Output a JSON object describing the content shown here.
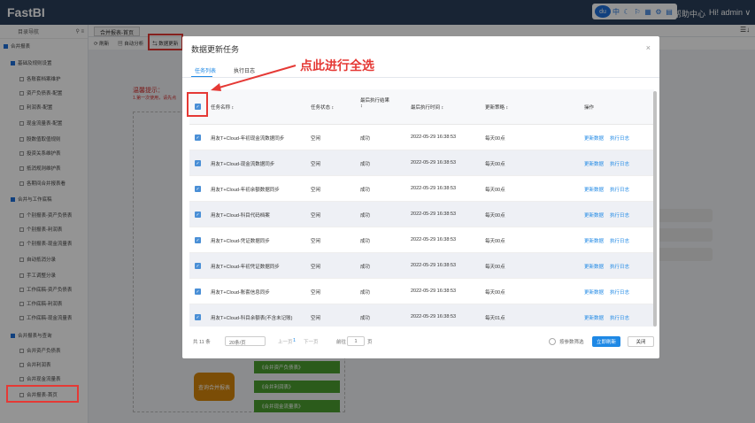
{
  "app": {
    "brand": "FastBI"
  },
  "topbar": {
    "icons": [
      "du-icon",
      "中",
      "☾",
      "⚐",
      "▦",
      "⚙",
      "▤"
    ],
    "help": "帮助中心",
    "user": "Hi! admin ∨"
  },
  "sidebar": {
    "head": "目录导航",
    "items": [
      {
        "label": "合并报表",
        "type": "group"
      },
      {
        "label": "基础及规则设置",
        "type": "group"
      },
      {
        "label": "各账套档案维护"
      },
      {
        "label": "资产负债表-配置"
      },
      {
        "label": "利润表-配置"
      },
      {
        "label": "现金流量表-配置"
      },
      {
        "label": "股数值取值规则"
      },
      {
        "label": "投资关系维护表"
      },
      {
        "label": "抵消规则维护表"
      },
      {
        "label": "各期间合并报表看"
      },
      {
        "label": "合并与工作底稿",
        "type": "group"
      },
      {
        "label": "个别报表-资产负债表"
      },
      {
        "label": "个别报表-利润表"
      },
      {
        "label": "个别报表-现金流量表"
      },
      {
        "label": "自动抵消分录"
      },
      {
        "label": "手工调整分录"
      },
      {
        "label": "工作底稿-资产负债表"
      },
      {
        "label": "工作底稿-利润表"
      },
      {
        "label": "工作底稿-现金流量表"
      },
      {
        "label": "合并报表与查询",
        "type": "group"
      },
      {
        "label": "合并资产负债表"
      },
      {
        "label": "合并利润表"
      },
      {
        "label": "合并现金流量表"
      },
      {
        "label": "合并报表-首页",
        "active": true
      }
    ]
  },
  "tabs": [
    {
      "label": "合并报表-首页"
    }
  ],
  "toolbar": {
    "refresh": "刷新",
    "auto": "自动分析",
    "update": "数据更新"
  },
  "background": {
    "note_title": "温馨提示：",
    "note_body": "1.第一次使用，请先点",
    "flow_center": "查询合并报表",
    "flow_items": [
      "《合并资产负债表》",
      "《合并利润表》",
      "《合并现金流量表》"
    ]
  },
  "annotation": "点此进行全选",
  "modal": {
    "title": "数据更新任务",
    "close": "×",
    "tabs": [
      "任务列表",
      "执行日志"
    ],
    "columns": [
      "任务名称",
      "任务状态",
      "最后执行结果",
      "最后执行时间",
      "更新策略",
      "操作"
    ],
    "column_sort": "↕",
    "rows": [
      {
        "name": "用友T+Cloud-年初现金流数据同步",
        "status": "空闲",
        "result": "成功",
        "time": "2022-05-29 16:38:53",
        "strategy": "每天00点"
      },
      {
        "name": "用友T+Cloud-现金流数据同步",
        "status": "空闲",
        "result": "成功",
        "time": "2022-05-29 16:38:53",
        "strategy": "每天00点"
      },
      {
        "name": "用友T+Cloud-年初余额数据同步",
        "status": "空闲",
        "result": "成功",
        "time": "2022-05-29 16:38:53",
        "strategy": "每天00点"
      },
      {
        "name": "用友T+Cloud-科目代码档案",
        "status": "空闲",
        "result": "成功",
        "time": "2022-05-29 16:38:53",
        "strategy": "每天00点"
      },
      {
        "name": "用友T+Cloud-凭证数据同步",
        "status": "空闲",
        "result": "成功",
        "time": "2022-05-29 16:38:53",
        "strategy": "每天00点"
      },
      {
        "name": "用友T+Cloud-年初凭证数据同步",
        "status": "空闲",
        "result": "成功",
        "time": "2022-05-29 16:38:53",
        "strategy": "每天00点"
      },
      {
        "name": "用友T+Cloud-账套信息同步",
        "status": "空闲",
        "result": "成功",
        "time": "2022-05-29 16:38:53",
        "strategy": "每天00点"
      },
      {
        "name": "用友T+Cloud-科目余额表(不含未记账)",
        "status": "空闲",
        "result": "成功",
        "time": "2022-05-29 16:38:53",
        "strategy": "每天01点"
      }
    ],
    "action_update": "更新数据",
    "action_log": "执行日志",
    "pager": {
      "total": "共 11 条",
      "size": "20条/页",
      "prev": "上一页",
      "page": "1",
      "next": "下一页",
      "goto": "前往",
      "goto_val": "1",
      "unit": "页"
    },
    "radio_label": "按参数筛选",
    "confirm": "立即刷新",
    "cancel": "关闭"
  }
}
